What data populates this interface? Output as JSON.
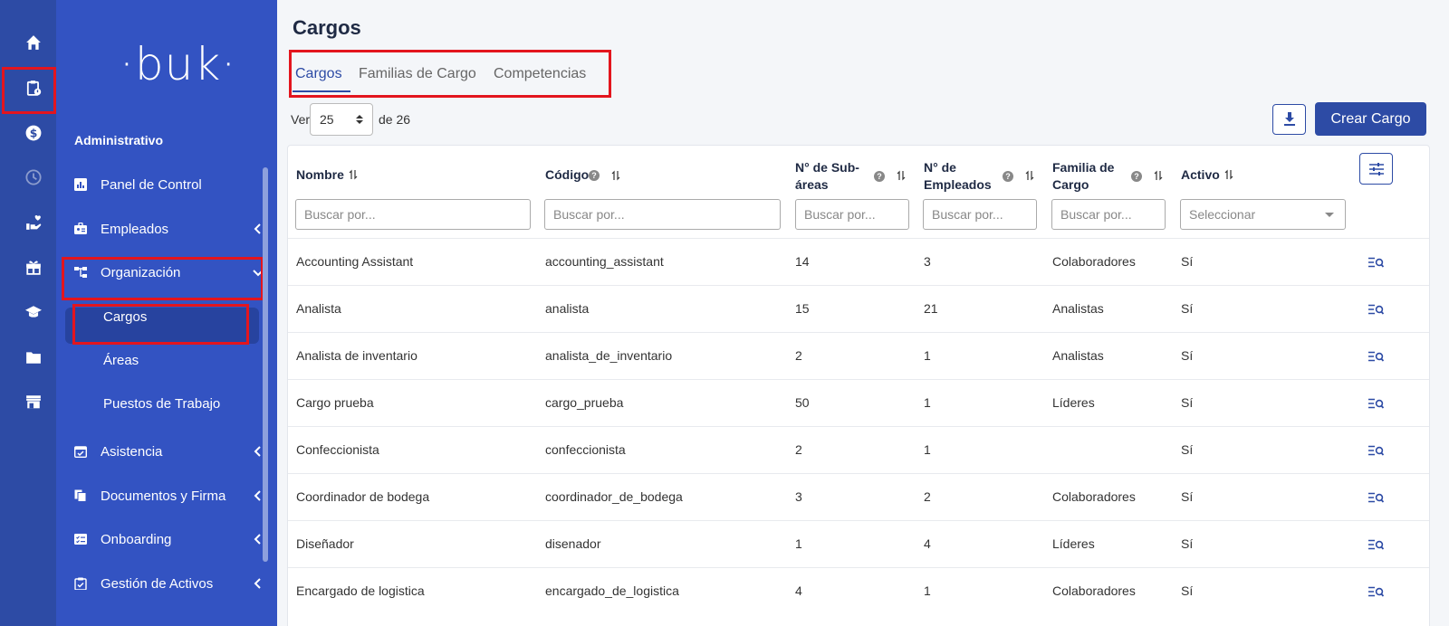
{
  "app": {
    "logo_text": "·buk·"
  },
  "sidebar": {
    "section_title": "Administrativo",
    "items": [
      {
        "label": "Panel de Control",
        "icon": "chart-icon"
      },
      {
        "label": "Empleados",
        "icon": "id-card-icon"
      },
      {
        "label": "Organización",
        "icon": "org-chart-icon"
      },
      {
        "label": "Asistencia",
        "icon": "calendar-check-icon"
      },
      {
        "label": "Documentos y Firma",
        "icon": "documents-icon"
      },
      {
        "label": "Onboarding",
        "icon": "checklist-icon"
      },
      {
        "label": "Gestión de Activos",
        "icon": "clipboard-icon"
      }
    ],
    "sub_items": [
      {
        "label": "Cargos"
      },
      {
        "label": "Áreas"
      },
      {
        "label": "Puestos de Trabajo"
      }
    ]
  },
  "rail": [
    "home-icon",
    "clipboard-user-icon",
    "dollar-icon",
    "clock-icon",
    "hand-heart-icon",
    "gift-icon",
    "graduation-cap-icon",
    "folder-icon",
    "store-icon"
  ],
  "main": {
    "title": "Cargos",
    "tabs": [
      {
        "label": "Cargos"
      },
      {
        "label": "Familias de Cargo"
      },
      {
        "label": "Competencias"
      }
    ],
    "pagination": {
      "ver_label": "Ver",
      "per_page": "25",
      "of_label": "de 26"
    },
    "create_button": "Crear Cargo"
  },
  "table": {
    "headers": {
      "name": "Nombre",
      "code": "Código",
      "subareas_1": "N° de Sub-",
      "subareas_2": "áreas",
      "employees_1": "N° de",
      "employees_2": "Empleados",
      "family_1": "Familia de",
      "family_2": "Cargo",
      "active": "Activo"
    },
    "filters": {
      "search_placeholder": "Buscar por...",
      "search_placeholder_short": "Buscar por...",
      "select_placeholder": "Seleccionar"
    },
    "rows": [
      {
        "name": "Accounting Assistant",
        "code": "accounting_assistant",
        "subareas": "14",
        "employees": "3",
        "family": "Colaboradores",
        "active": "Sí"
      },
      {
        "name": "Analista",
        "code": "analista",
        "subareas": "15",
        "employees": "21",
        "family": "Analistas",
        "active": "Sí"
      },
      {
        "name": "Analista de inventario",
        "code": "analista_de_inventario",
        "subareas": "2",
        "employees": "1",
        "family": "Analistas",
        "active": "Sí"
      },
      {
        "name": "Cargo prueba",
        "code": "cargo_prueba",
        "subareas": "50",
        "employees": "1",
        "family": "Líderes",
        "active": "Sí"
      },
      {
        "name": "Confeccionista",
        "code": "confeccionista",
        "subareas": "2",
        "employees": "1",
        "family": "",
        "active": "Sí"
      },
      {
        "name": "Coordinador de bodega",
        "code": "coordinador_de_bodega",
        "subareas": "3",
        "employees": "2",
        "family": "Colaboradores",
        "active": "Sí"
      },
      {
        "name": "Diseñador",
        "code": "disenador",
        "subareas": "1",
        "employees": "4",
        "family": "Líderes",
        "active": "Sí"
      },
      {
        "name": "Encargado de logistica",
        "code": "encargado_de_logistica",
        "subareas": "4",
        "employees": "1",
        "family": "Colaboradores",
        "active": "Sí"
      }
    ]
  },
  "colors": {
    "primary": "#2d4ba5",
    "sidebar": "#3353c2",
    "rail": "#2d4ba5",
    "highlight": "#e3151e"
  }
}
